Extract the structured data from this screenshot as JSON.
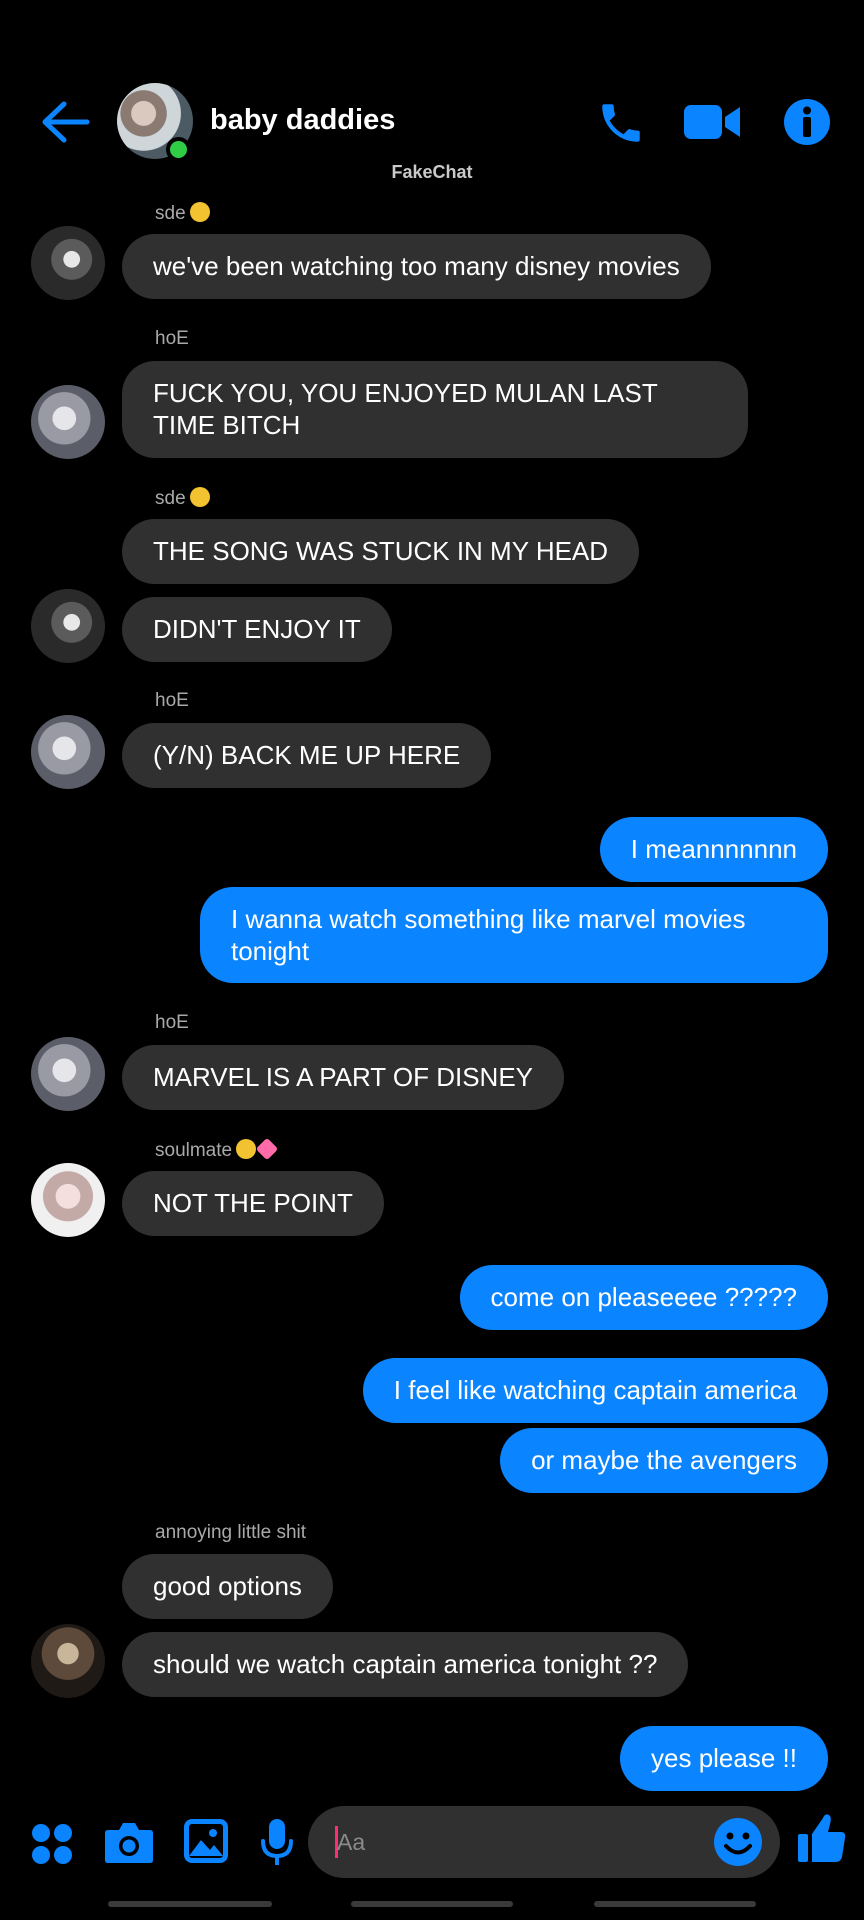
{
  "header": {
    "title": "baby daddies",
    "watermark": "FakeChat"
  },
  "colors": {
    "accent": "#0a84ff",
    "incoming_bubble": "#303030",
    "online": "#31cc46",
    "background": "#000000"
  },
  "messages": [
    {
      "sender": "sde",
      "text": "we've been watching too many disney movies"
    },
    {
      "sender": "hoE",
      "text": "FUCK YOU, YOU ENJOYED MULAN LAST TIME BITCH"
    },
    {
      "sender": "sde",
      "text": "THE SONG WAS STUCK IN MY HEAD"
    },
    {
      "text": "DIDN'T ENJOY IT"
    },
    {
      "sender": "hoE",
      "text": "(Y/N) BACK ME UP HERE"
    },
    {
      "text": "I meannnnnnn"
    },
    {
      "text": "I wanna watch something like marvel movies tonight"
    },
    {
      "sender": "hoE",
      "text": "MARVEL IS A PART OF DISNEY"
    },
    {
      "sender": "soulmate",
      "text": "NOT THE POINT"
    },
    {
      "text": "come on pleaseeee ?????"
    },
    {
      "text": "I feel like watching captain america"
    },
    {
      "text": "or maybe the avengers"
    },
    {
      "sender": "annoying little shit",
      "text": "good options"
    },
    {
      "text": "should we watch captain america tonight ??"
    },
    {
      "text": "yes please !!"
    }
  ],
  "composer": {
    "placeholder": "Aa"
  },
  "icons": [
    "back-arrow-icon",
    "phone-icon",
    "video-call-icon",
    "info-icon",
    "apps-grid-icon",
    "camera-icon",
    "gallery-icon",
    "microphone-icon",
    "emoji-icon",
    "thumbs-up-icon"
  ]
}
